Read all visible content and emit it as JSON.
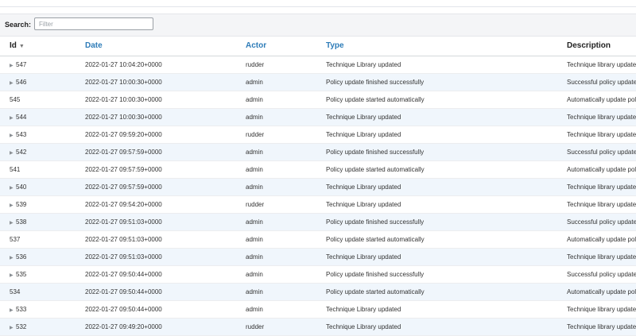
{
  "search": {
    "label": "Search:",
    "placeholder": "Filter"
  },
  "columns": {
    "id": "Id",
    "date": "Date",
    "actor": "Actor",
    "type": "Type",
    "description": "Description"
  },
  "rows": [
    {
      "id": "547",
      "expandable": true,
      "date": "2022-01-27 10:04:20+0000",
      "actor": "rudder",
      "type": "Technique Library updated",
      "description": "Technique library updated"
    },
    {
      "id": "546",
      "expandable": true,
      "date": "2022-01-27 10:00:30+0000",
      "actor": "admin",
      "type": "Policy update finished successfully",
      "description": "Successful policy update"
    },
    {
      "id": "545",
      "expandable": false,
      "date": "2022-01-27 10:00:30+0000",
      "actor": "admin",
      "type": "Policy update started automatically",
      "description": "Automatically update policies"
    },
    {
      "id": "544",
      "expandable": true,
      "date": "2022-01-27 10:00:30+0000",
      "actor": "admin",
      "type": "Technique Library updated",
      "description": "Technique library updated"
    },
    {
      "id": "543",
      "expandable": true,
      "date": "2022-01-27 09:59:20+0000",
      "actor": "rudder",
      "type": "Technique Library updated",
      "description": "Technique library updated"
    },
    {
      "id": "542",
      "expandable": true,
      "date": "2022-01-27 09:57:59+0000",
      "actor": "admin",
      "type": "Policy update finished successfully",
      "description": "Successful policy update"
    },
    {
      "id": "541",
      "expandable": false,
      "date": "2022-01-27 09:57:59+0000",
      "actor": "admin",
      "type": "Policy update started automatically",
      "description": "Automatically update policies"
    },
    {
      "id": "540",
      "expandable": true,
      "date": "2022-01-27 09:57:59+0000",
      "actor": "admin",
      "type": "Technique Library updated",
      "description": "Technique library updated"
    },
    {
      "id": "539",
      "expandable": true,
      "date": "2022-01-27 09:54:20+0000",
      "actor": "rudder",
      "type": "Technique Library updated",
      "description": "Technique library updated"
    },
    {
      "id": "538",
      "expandable": true,
      "date": "2022-01-27 09:51:03+0000",
      "actor": "admin",
      "type": "Policy update finished successfully",
      "description": "Successful policy update"
    },
    {
      "id": "537",
      "expandable": false,
      "date": "2022-01-27 09:51:03+0000",
      "actor": "admin",
      "type": "Policy update started automatically",
      "description": "Automatically update policies"
    },
    {
      "id": "536",
      "expandable": true,
      "date": "2022-01-27 09:51:03+0000",
      "actor": "admin",
      "type": "Technique Library updated",
      "description": "Technique library updated"
    },
    {
      "id": "535",
      "expandable": true,
      "date": "2022-01-27 09:50:44+0000",
      "actor": "admin",
      "type": "Policy update finished successfully",
      "description": "Successful policy update"
    },
    {
      "id": "534",
      "expandable": false,
      "date": "2022-01-27 09:50:44+0000",
      "actor": "admin",
      "type": "Policy update started automatically",
      "description": "Automatically update policies"
    },
    {
      "id": "533",
      "expandable": true,
      "date": "2022-01-27 09:50:44+0000",
      "actor": "admin",
      "type": "Technique Library updated",
      "description": "Technique library updated"
    },
    {
      "id": "532",
      "expandable": true,
      "date": "2022-01-27 09:49:20+0000",
      "actor": "rudder",
      "type": "Technique Library updated",
      "description": "Technique library updated"
    }
  ]
}
